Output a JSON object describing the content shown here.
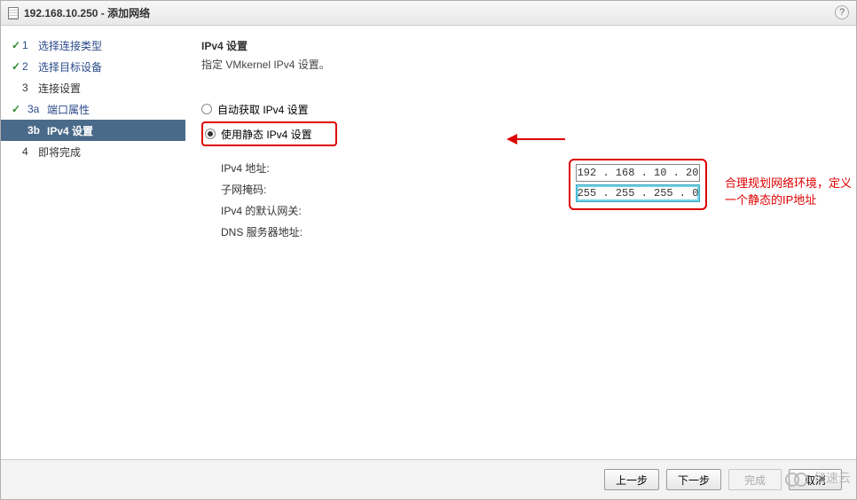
{
  "titlebar": {
    "title": "192.168.10.250 - 添加网络"
  },
  "sidebar": {
    "steps": [
      {
        "num": "1",
        "label": "选择连接类型",
        "done": true
      },
      {
        "num": "2",
        "label": "选择目标设备",
        "done": true
      },
      {
        "num": "3",
        "label": "连接设置",
        "done": false
      },
      {
        "num": "3a",
        "label": "端口属性",
        "done": true,
        "sub": true
      },
      {
        "num": "3b",
        "label": "IPv4 设置",
        "active": true,
        "sub": true
      },
      {
        "num": "4",
        "label": "即将完成",
        "done": false
      }
    ]
  },
  "content": {
    "title": "IPv4 设置",
    "desc": "指定 VMkernel IPv4 设置。",
    "radio_auto": "自动获取 IPv4 设置",
    "radio_static": "使用静态 IPv4 设置",
    "labels": {
      "ipv4_addr": "IPv4 地址:",
      "subnet": "子网掩码:",
      "gateway": "IPv4 的默认网关:",
      "dns": "DNS 服务器地址:"
    },
    "values": {
      "ipv4_addr": "192 . 168 .  10 .  20",
      "subnet": "255 . 255 . 255 .   0"
    }
  },
  "annotation": "合理规划网络环境，定义一个静态的IP地址",
  "footer": {
    "back": "上一步",
    "next": "下一步",
    "finish": "完成",
    "cancel": "取消"
  },
  "watermark": "亿速云"
}
